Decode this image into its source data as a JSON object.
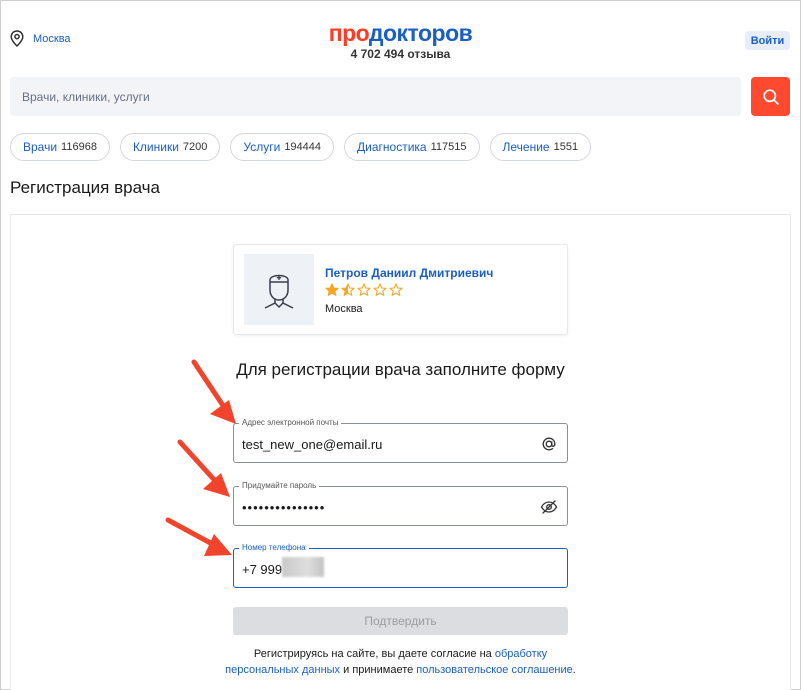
{
  "header": {
    "city": "Москва",
    "logo_part1": "про",
    "logo_part2": "докторов",
    "reviews": "4 702 494 отзыва",
    "login_label": "Войти"
  },
  "search": {
    "placeholder": "Врачи, клиники, услуги"
  },
  "chips": [
    {
      "label": "Врачи",
      "count": "116968"
    },
    {
      "label": "Клиники",
      "count": "7200"
    },
    {
      "label": "Услуги",
      "count": "194444"
    },
    {
      "label": "Диагностика",
      "count": "117515"
    },
    {
      "label": "Лечение",
      "count": "1551"
    }
  ],
  "page_title": "Регистрация врача",
  "doctor": {
    "name": "Петров Даниил Дмитриевич",
    "rating": 1.5,
    "rating_max": 5,
    "city": "Москва"
  },
  "form": {
    "title": "Для регистрации врача заполните форму",
    "email_label": "Адрес электронной почты",
    "email_value": "test_new_one@email.ru",
    "password_label": "Придумайте пароль",
    "password_value": "•••••••••••••••",
    "phone_label": "Номер телефона",
    "phone_value": "+7 999",
    "submit_label": "Подтвердить"
  },
  "consent": {
    "text1": "Регистрируясь на сайте, вы даете согласие на ",
    "link1": "обработку персональных данных",
    "text2": " и принимаете ",
    "link2": "пользовательское соглашение",
    "text3": "."
  },
  "colors": {
    "brand_red": "#ff3b24",
    "brand_blue": "#1a5fc4",
    "star": "#f5a623",
    "annotation_arrow": "#f0442c"
  }
}
